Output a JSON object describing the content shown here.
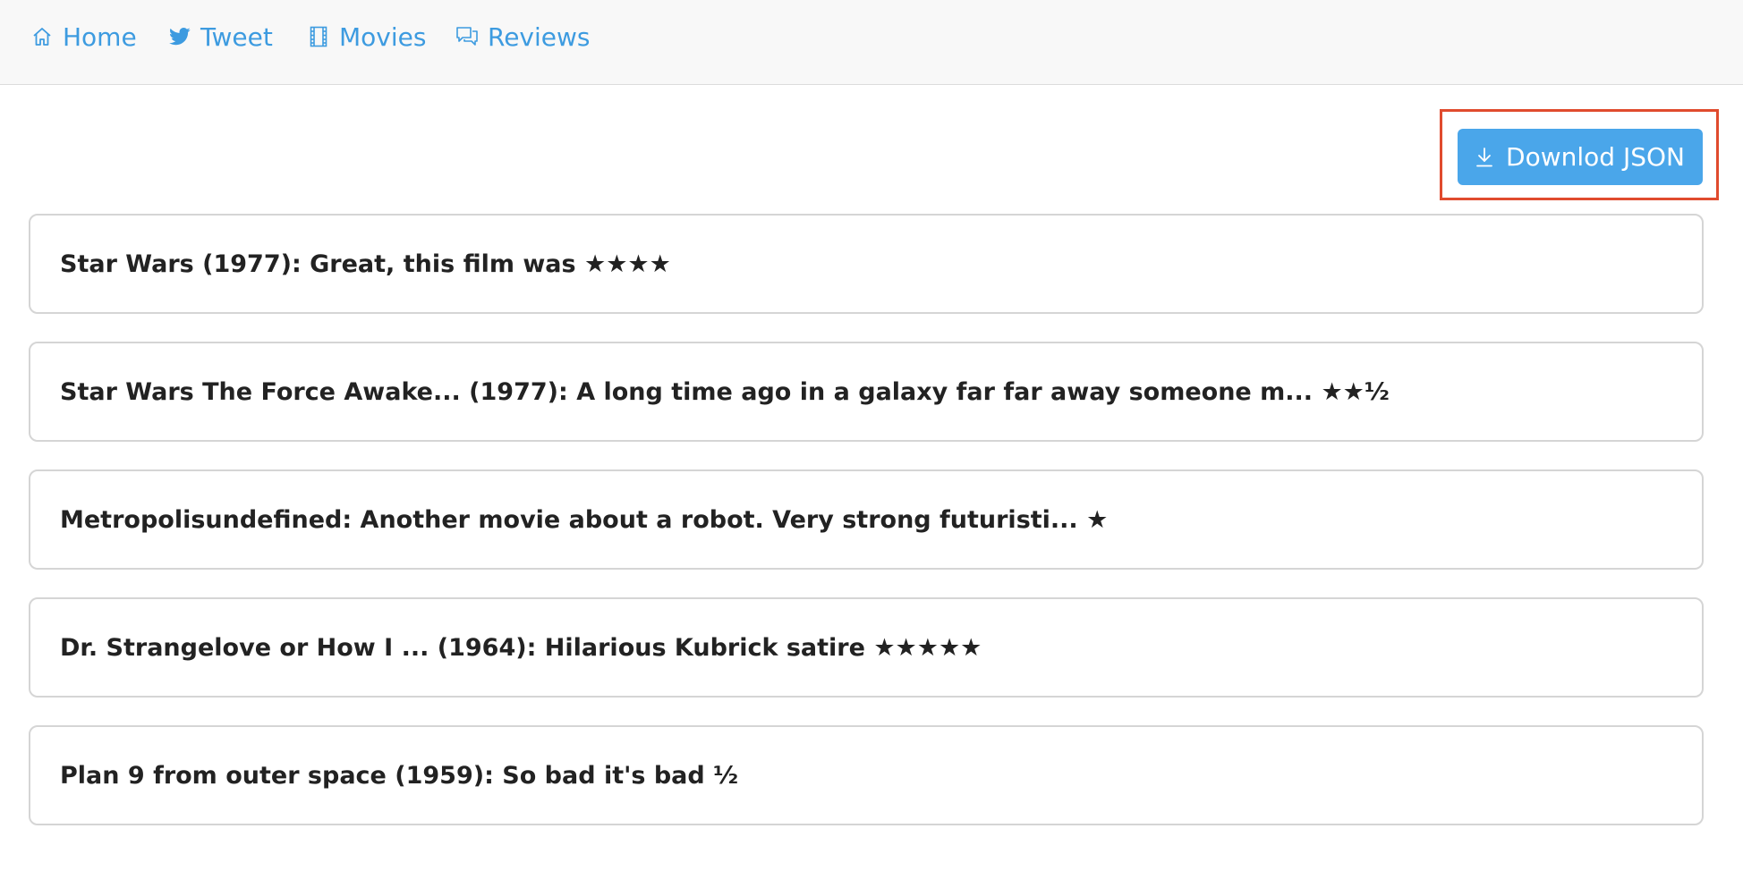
{
  "nav": {
    "items": [
      {
        "label": "Home",
        "icon": "home-icon"
      },
      {
        "label": "Tweet",
        "icon": "twitter-icon"
      },
      {
        "label": "Movies",
        "icon": "film-icon"
      },
      {
        "label": "Reviews",
        "icon": "chat-icon"
      }
    ]
  },
  "toolbar": {
    "download_label": "Downlod JSON",
    "download_icon": "download-icon"
  },
  "reviews": [
    {
      "text": "Star Wars (1977): Great, this film was ★★★★"
    },
    {
      "text": "Star Wars The Force Awake... (1977): A long time ago in a galaxy far far away someone m... ★★½"
    },
    {
      "text": "Metropolisundefined: Another movie about a robot. Very strong futuristi... ★"
    },
    {
      "text": "Dr. Strangelove or How I ... (1964): Hilarious Kubrick satire ★★★★★"
    },
    {
      "text": "Plan 9 from outer space (1959): So bad it's bad ½"
    }
  ],
  "colors": {
    "accent": "#3d9be0",
    "button": "#4aa6ea",
    "highlight": "#e04b2e"
  }
}
